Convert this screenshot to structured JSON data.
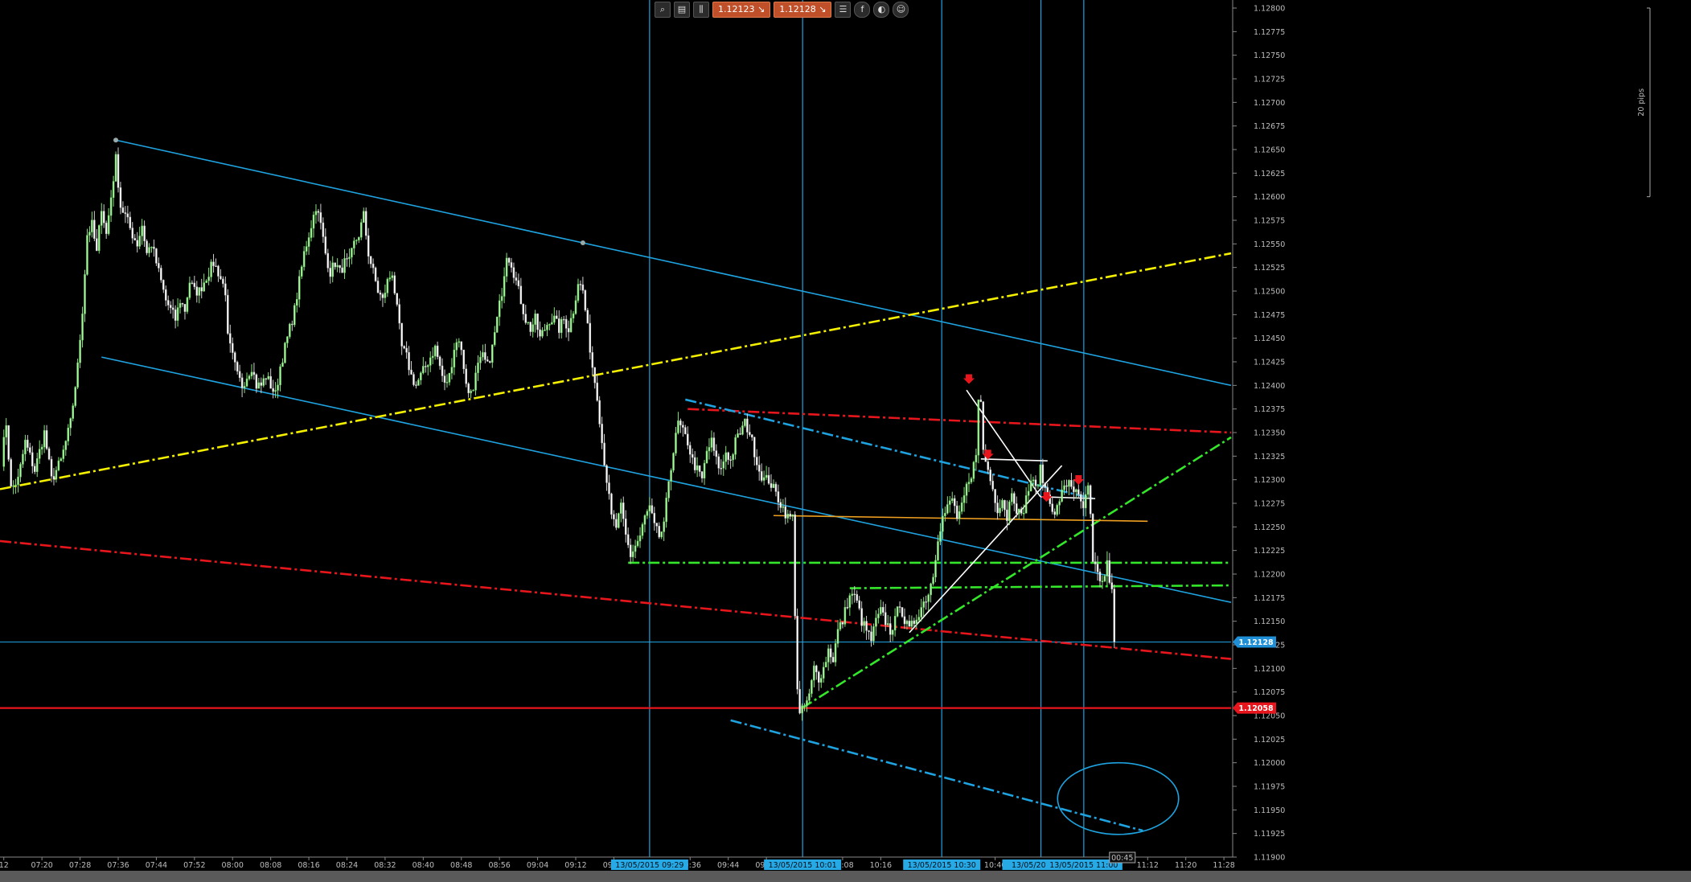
{
  "toolbar": {
    "bid": "1.12123",
    "ask": "1.12128",
    "bid_arrow": "↘",
    "ask_arrow": "↘",
    "icons": [
      "zoom-icon",
      "chart-type-icon",
      "candles-icon",
      "list-icon",
      "facebook-icon",
      "share-icon",
      "profile-icon"
    ]
  },
  "colors": {
    "bull": "#a9f7a0",
    "bear": "#ffffff",
    "channel": "#1ea3e0",
    "yellow": "#f4f000",
    "red": "#e8161c",
    "green": "#34e72a",
    "orange": "#f0a020",
    "white_line": "#ffffff",
    "price_tag": "#1f8fd8",
    "level_tag": "#e8161c",
    "time_tag": "#27a9e6"
  },
  "chart_data": {
    "type": "candlestick",
    "instrument_pips_label": "20 pips",
    "ylim": [
      1.119,
      1.128
    ],
    "y_ticks": [
      1.128,
      1.12775,
      1.1275,
      1.12725,
      1.127,
      1.12675,
      1.1265,
      1.12625,
      1.126,
      1.12575,
      1.1255,
      1.12525,
      1.125,
      1.12475,
      1.1245,
      1.12425,
      1.124,
      1.12375,
      1.1235,
      1.12325,
      1.123,
      1.12275,
      1.1225,
      1.12225,
      1.122,
      1.12175,
      1.1215,
      1.12125,
      1.121,
      1.12075,
      1.1205,
      1.12025,
      1.12,
      1.11975,
      1.1195,
      1.11925,
      1.119
    ],
    "x_ticks": [
      {
        "label": "12",
        "minute": 432
      },
      {
        "label": "07:20",
        "minute": 440
      },
      {
        "label": "07:28",
        "minute": 448
      },
      {
        "label": "07:36",
        "minute": 456
      },
      {
        "label": "07:44",
        "minute": 464
      },
      {
        "label": "07:52",
        "minute": 472
      },
      {
        "label": "08:00",
        "minute": 480
      },
      {
        "label": "08:08",
        "minute": 488
      },
      {
        "label": "08:16",
        "minute": 496
      },
      {
        "label": "08:24",
        "minute": 504
      },
      {
        "label": "08:32",
        "minute": 512
      },
      {
        "label": "08:40",
        "minute": 520
      },
      {
        "label": "08:48",
        "minute": 528
      },
      {
        "label": "08:56",
        "minute": 536
      },
      {
        "label": "09:04",
        "minute": 544
      },
      {
        "label": "09:12",
        "minute": 552
      },
      {
        "label": "09:20",
        "minute": 560
      },
      {
        "label": "09:36",
        "minute": 576
      },
      {
        "label": "09:44",
        "minute": 584
      },
      {
        "label": "09:52",
        "minute": 592
      },
      {
        "label": "10:08",
        "minute": 608
      },
      {
        "label": "10:16",
        "minute": 616
      },
      {
        "label": "10:40",
        "minute": 640
      },
      {
        "label": "11:04",
        "minute": 664
      },
      {
        "label": "11:12",
        "minute": 672
      },
      {
        "label": "11:20",
        "minute": 680
      },
      {
        "label": "11:28",
        "minute": 688
      }
    ],
    "x_start_minute": 431.2,
    "x_end_minute": 689.5,
    "candle_minutes": 0.5,
    "anchors": [
      [
        431.5,
        1.1232
      ],
      [
        432.5,
        1.1236
      ],
      [
        433.5,
        1.1229
      ],
      [
        435,
        1.123
      ],
      [
        436.5,
        1.1234
      ],
      [
        438.5,
        1.1231
      ],
      [
        440.5,
        1.1235
      ],
      [
        442,
        1.123
      ],
      [
        444,
        1.1232
      ],
      [
        446,
        1.1236
      ],
      [
        447.5,
        1.1242
      ],
      [
        448.5,
        1.1248
      ],
      [
        449.5,
        1.1256
      ],
      [
        450.5,
        1.1257
      ],
      [
        451.5,
        1.1254
      ],
      [
        452.5,
        1.1259
      ],
      [
        453.5,
        1.1256
      ],
      [
        454.5,
        1.126
      ],
      [
        455.5,
        1.1264
      ],
      [
        456.5,
        1.1259
      ],
      [
        457.5,
        1.1258
      ],
      [
        459,
        1.1256
      ],
      [
        460,
        1.1255
      ],
      [
        461,
        1.1257
      ],
      [
        462,
        1.1254
      ],
      [
        463,
        1.1255
      ],
      [
        464,
        1.1253
      ],
      [
        465,
        1.1251
      ],
      [
        466,
        1.1249
      ],
      [
        467,
        1.1248
      ],
      [
        468,
        1.1247
      ],
      [
        469,
        1.1249
      ],
      [
        470,
        1.1248
      ],
      [
        471,
        1.1251
      ],
      [
        472,
        1.125
      ],
      [
        473,
        1.125
      ],
      [
        474,
        1.1251
      ],
      [
        475,
        1.1252
      ],
      [
        476,
        1.1253
      ],
      [
        477,
        1.1252
      ],
      [
        478.5,
        1.125
      ],
      [
        479,
        1.1245
      ],
      [
        480,
        1.1243
      ],
      [
        481,
        1.1241
      ],
      [
        482,
        1.124
      ],
      [
        483,
        1.1241
      ],
      [
        484,
        1.1242
      ],
      [
        485,
        1.124
      ],
      [
        486,
        1.124
      ],
      [
        487,
        1.1241
      ],
      [
        488,
        1.124
      ],
      [
        489,
        1.1239
      ],
      [
        490,
        1.1242
      ],
      [
        491,
        1.1244
      ],
      [
        492,
        1.1246
      ],
      [
        493,
        1.1248
      ],
      [
        494,
        1.1251
      ],
      [
        495,
        1.1254
      ],
      [
        496,
        1.1256
      ],
      [
        497,
        1.1258
      ],
      [
        497.5,
        1.1259
      ],
      [
        498.5,
        1.1257
      ],
      [
        499.5,
        1.1254
      ],
      [
        500.5,
        1.1252
      ],
      [
        501.5,
        1.1253
      ],
      [
        502.5,
        1.1252
      ],
      [
        503.5,
        1.1253
      ],
      [
        504.5,
        1.1253
      ],
      [
        505.5,
        1.1255
      ],
      [
        506.5,
        1.1256
      ],
      [
        507.5,
        1.1258
      ],
      [
        508.5,
        1.1254
      ],
      [
        509.5,
        1.1252
      ],
      [
        510.5,
        1.125
      ],
      [
        511.5,
        1.1249
      ],
      [
        512.5,
        1.1251
      ],
      [
        513.5,
        1.1252
      ],
      [
        514.5,
        1.1248
      ],
      [
        515.5,
        1.1244
      ],
      [
        516.5,
        1.1243
      ],
      [
        517.5,
        1.1241
      ],
      [
        518.5,
        1.124
      ],
      [
        519.5,
        1.1241
      ],
      [
        520.5,
        1.1242
      ],
      [
        521.5,
        1.1243
      ],
      [
        522.5,
        1.1244
      ],
      [
        523.5,
        1.1242
      ],
      [
        524.5,
        1.124
      ],
      [
        525.5,
        1.1241
      ],
      [
        526.5,
        1.1244
      ],
      [
        527.5,
        1.1245
      ],
      [
        528.5,
        1.1242
      ],
      [
        529.5,
        1.1239
      ],
      [
        530.5,
        1.124
      ],
      [
        531.5,
        1.1242
      ],
      [
        532.5,
        1.1243
      ],
      [
        533.5,
        1.1242
      ],
      [
        534.5,
        1.1244
      ],
      [
        535.5,
        1.1247
      ],
      [
        536.5,
        1.125
      ],
      [
        537.5,
        1.1254
      ],
      [
        538.5,
        1.1253
      ],
      [
        539.5,
        1.1251
      ],
      [
        540.5,
        1.1249
      ],
      [
        541.5,
        1.1247
      ],
      [
        542.5,
        1.1246
      ],
      [
        543.5,
        1.1247
      ],
      [
        544.5,
        1.1245
      ],
      [
        545.5,
        1.1246
      ],
      [
        546.5,
        1.1247
      ],
      [
        547.5,
        1.1247
      ],
      [
        548.5,
        1.1246
      ],
      [
        549.5,
        1.1247
      ],
      [
        550.5,
        1.1246
      ],
      [
        551.5,
        1.1248
      ],
      [
        552.5,
        1.1251
      ],
      [
        553.5,
        1.125
      ],
      [
        554.5,
        1.1246
      ],
      [
        555.5,
        1.1242
      ],
      [
        556.5,
        1.1239
      ],
      [
        557.5,
        1.1234
      ],
      [
        558.5,
        1.123
      ],
      [
        559.5,
        1.1226
      ],
      [
        560.5,
        1.1225
      ],
      [
        561.5,
        1.1227
      ],
      [
        562.5,
        1.1224
      ],
      [
        563.5,
        1.1222
      ],
      [
        564.5,
        1.1223
      ],
      [
        565.5,
        1.1224
      ],
      [
        566.5,
        1.1226
      ],
      [
        567.5,
        1.1227
      ],
      [
        568.5,
        1.1225
      ],
      [
        569.5,
        1.1224
      ],
      [
        570.5,
        1.1225
      ],
      [
        571.5,
        1.123
      ],
      [
        572.5,
        1.1233
      ],
      [
        573.5,
        1.1236
      ],
      [
        574.5,
        1.1235
      ],
      [
        575.5,
        1.1234
      ],
      [
        576.5,
        1.1232
      ],
      [
        577.5,
        1.1231
      ],
      [
        578.5,
        1.123
      ],
      [
        579.5,
        1.1233
      ],
      [
        580.5,
        1.1234
      ],
      [
        581.5,
        1.1232
      ],
      [
        582.5,
        1.1231
      ],
      [
        583.5,
        1.1233
      ],
      [
        584.5,
        1.1232
      ],
      [
        585.5,
        1.1234
      ],
      [
        586.5,
        1.1235
      ],
      [
        587.5,
        1.1236
      ],
      [
        588.5,
        1.1235
      ],
      [
        589.5,
        1.1233
      ],
      [
        590.5,
        1.1231
      ],
      [
        591.5,
        1.123
      ],
      [
        592.5,
        1.123
      ],
      [
        593.5,
        1.1229
      ],
      [
        594.5,
        1.1228
      ],
      [
        595.5,
        1.1227
      ],
      [
        596.5,
        1.1226
      ],
      [
        597.5,
        1.1226
      ],
      [
        598,
        1.1216
      ],
      [
        598.5,
        1.1208
      ],
      [
        599,
        1.1205
      ],
      [
        600,
        1.1206
      ],
      [
        601,
        1.1207
      ],
      [
        602,
        1.121
      ],
      [
        603,
        1.1209
      ],
      [
        604,
        1.121
      ],
      [
        605,
        1.1212
      ],
      [
        606,
        1.1211
      ],
      [
        607,
        1.1214
      ],
      [
        608,
        1.1215
      ],
      [
        609,
        1.1217
      ],
      [
        610,
        1.1218
      ],
      [
        611,
        1.1217
      ],
      [
        612,
        1.1215
      ],
      [
        613,
        1.1214
      ],
      [
        614,
        1.1213
      ],
      [
        615,
        1.1215
      ],
      [
        616,
        1.1216
      ],
      [
        617,
        1.1215
      ],
      [
        618,
        1.1214
      ],
      [
        619,
        1.1215
      ],
      [
        620,
        1.1217
      ],
      [
        621,
        1.1215
      ],
      [
        622,
        1.1214
      ],
      [
        623,
        1.1215
      ],
      [
        624,
        1.1216
      ],
      [
        625,
        1.1217
      ],
      [
        626,
        1.1218
      ],
      [
        627,
        1.122
      ],
      [
        628,
        1.1224
      ],
      [
        629,
        1.1226
      ],
      [
        630,
        1.1227
      ],
      [
        631,
        1.1228
      ],
      [
        632,
        1.1226
      ],
      [
        633,
        1.1227
      ],
      [
        634,
        1.1229
      ],
      [
        635,
        1.123
      ],
      [
        636,
        1.1233
      ],
      [
        636.5,
        1.1239
      ],
      [
        637,
        1.1238
      ],
      [
        637.5,
        1.1233
      ],
      [
        638.5,
        1.1231
      ],
      [
        639.5,
        1.1229
      ],
      [
        640.5,
        1.1227
      ],
      [
        641.5,
        1.1228
      ],
      [
        642.5,
        1.1226
      ],
      [
        643.5,
        1.1229
      ],
      [
        644.5,
        1.1227
      ],
      [
        645.5,
        1.1226
      ],
      [
        646.5,
        1.1228
      ],
      [
        647.5,
        1.123
      ],
      [
        648.5,
        1.1229
      ],
      [
        649.5,
        1.1231
      ],
      [
        650.5,
        1.1229
      ],
      [
        651.5,
        1.1228
      ],
      [
        652.5,
        1.1226
      ],
      [
        653.5,
        1.1228
      ],
      [
        654.5,
        1.1229
      ],
      [
        655.5,
        1.123
      ],
      [
        656.5,
        1.1229
      ],
      [
        657.5,
        1.1228
      ],
      [
        658.5,
        1.1227
      ],
      [
        659.5,
        1.1229
      ],
      [
        660,
        1.1226
      ],
      [
        660.5,
        1.1221
      ],
      [
        661.5,
        1.122
      ],
      [
        662.5,
        1.1219
      ],
      [
        663.5,
        1.1221
      ],
      [
        664.5,
        1.1218
      ],
      [
        665,
        1.12128
      ]
    ],
    "current_price": {
      "label": "1.12128",
      "value": 1.12128
    },
    "support_level": {
      "label": "1.12058",
      "value": 1.12058
    },
    "vlines": [
      {
        "minute": 567.5,
        "label": "13/05/2015 09:29"
      },
      {
        "minute": 599.6,
        "label": "13/05/2015 10:01"
      },
      {
        "minute": 628.8,
        "label": "13/05/2015 10:30"
      },
      {
        "minute": 649.6,
        "label": "13/05/2015 10:"
      },
      {
        "minute": 658.6,
        "label": "13/05/2015 11:00"
      }
    ],
    "cursor_time_label": "00:45",
    "trendlines": [
      {
        "name": "upper-channel",
        "color": "channel",
        "style": "solid",
        "points": [
          [
            455.5,
            1.1266
          ],
          [
            689.5,
            1.124
          ]
        ]
      },
      {
        "name": "lower-channel",
        "color": "channel",
        "style": "solid",
        "points": [
          [
            452.5,
            1.1243
          ],
          [
            689.5,
            1.1217
          ]
        ]
      },
      {
        "name": "yellow-support",
        "color": "yellow",
        "style": "dashdot",
        "points": [
          [
            431.2,
            1.1229
          ],
          [
            689.5,
            1.1254
          ]
        ]
      },
      {
        "name": "red-lower",
        "color": "red",
        "style": "dashdot",
        "points": [
          [
            431.2,
            1.12235
          ],
          [
            689.5,
            1.1211
          ]
        ]
      },
      {
        "name": "red-upper",
        "color": "red",
        "style": "dashdot",
        "points": [
          [
            575.5,
            1.12375
          ],
          [
            689.5,
            1.1235
          ]
        ]
      },
      {
        "name": "blue-dash-upper",
        "color": "channel",
        "style": "dashdot",
        "points": [
          [
            575,
            1.12385
          ],
          [
            660.5,
            1.1228
          ]
        ]
      },
      {
        "name": "blue-dash-lower",
        "color": "channel",
        "style": "dashdot",
        "points": [
          [
            584.5,
            1.12045
          ],
          [
            671,
            1.11928
          ]
        ]
      },
      {
        "name": "green-flat-1",
        "color": "green",
        "style": "dashdot",
        "points": [
          [
            563,
            1.12212
          ],
          [
            689.5,
            1.12212
          ]
        ]
      },
      {
        "name": "green-flat-2",
        "color": "green",
        "style": "dashdot",
        "points": [
          [
            609.5,
            1.12185
          ],
          [
            689.5,
            1.12188
          ]
        ]
      },
      {
        "name": "green-rising",
        "color": "green",
        "style": "dashdot",
        "points": [
          [
            599.5,
            1.12058
          ],
          [
            689.5,
            1.12345
          ]
        ]
      },
      {
        "name": "orange-flat",
        "color": "orange",
        "style": "solid",
        "points": [
          [
            593.5,
            1.12262
          ],
          [
            672,
            1.12256
          ]
        ]
      },
      {
        "name": "white-rise",
        "color": "white_line",
        "style": "solid",
        "points": [
          [
            622,
            1.12138
          ],
          [
            654,
            1.12315
          ]
        ]
      },
      {
        "name": "white-top",
        "color": "white_line",
        "style": "solid",
        "points": [
          [
            634,
            1.12395
          ],
          [
            649.5,
            1.12282
          ]
        ]
      },
      {
        "name": "white-top-b",
        "color": "white_line",
        "style": "solid",
        "points": [
          [
            649.5,
            1.12282
          ],
          [
            661,
            1.1228
          ]
        ]
      },
      {
        "name": "white-flat",
        "color": "white_line",
        "style": "solid",
        "points": [
          [
            637,
            1.12322
          ],
          [
            651,
            1.1232
          ]
        ]
      }
    ],
    "ellipse": {
      "center": [
        665.8,
        1.11962
      ],
      "rx_minutes": 12.7,
      "ry_price": 0.00038
    },
    "down_arrows": [
      [
        634.5,
        1.12405
      ],
      [
        638.5,
        1.12325
      ],
      [
        657.5,
        1.12298
      ],
      [
        650.8,
        1.1228
      ]
    ]
  }
}
